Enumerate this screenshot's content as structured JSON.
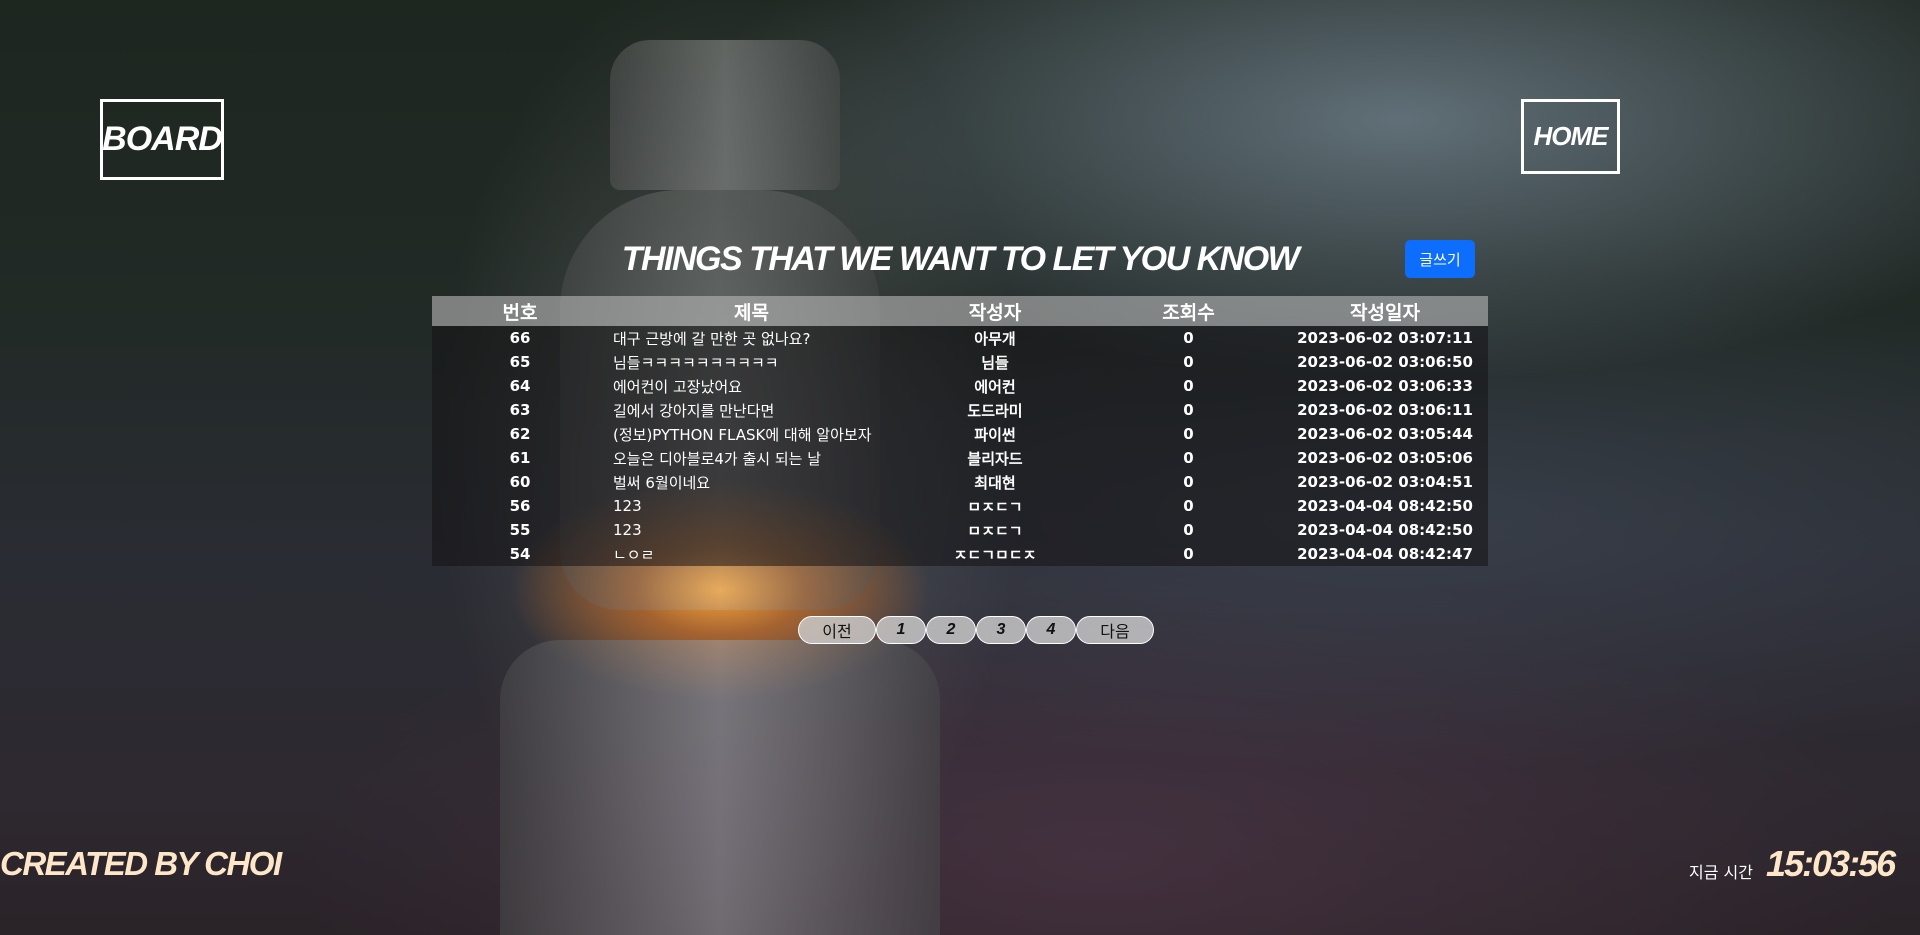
{
  "header": {
    "board_label": "BOARD",
    "home_label": "HOME"
  },
  "main": {
    "title": "THINGS THAT WE WANT TO LET YOU KNOW",
    "write_label": "글쓰기"
  },
  "table": {
    "columns": [
      "번호",
      "제목",
      "작성자",
      "조회수",
      "작성일자"
    ],
    "rows": [
      [
        "66",
        "대구 근방에 갈 만한 곳 없나요?",
        "아무개",
        "0",
        "2023-06-02 03:07:11"
      ],
      [
        "65",
        "님들ㅋㅋㅋㅋㅋㅋㅋㅋㅋㅋ",
        "님들",
        "0",
        "2023-06-02 03:06:50"
      ],
      [
        "64",
        "에어컨이 고장났어요",
        "에어컨",
        "0",
        "2023-06-02 03:06:33"
      ],
      [
        "63",
        "길에서 강아지를 만난다면",
        "도드라미",
        "0",
        "2023-06-02 03:06:11"
      ],
      [
        "62",
        "(정보)PYTHON FLASK에 대해 알아보자",
        "파이썬",
        "0",
        "2023-06-02 03:05:44"
      ],
      [
        "61",
        "오늘은 디아블로4가 출시 되는 날",
        "블리자드",
        "0",
        "2023-06-02 03:05:06"
      ],
      [
        "60",
        "벌써 6월이네요",
        "최대현",
        "0",
        "2023-06-02 03:04:51"
      ],
      [
        "56",
        "123",
        "ㅁㅈㄷㄱ",
        "0",
        "2023-04-04 08:42:50"
      ],
      [
        "55",
        "123",
        "ㅁㅈㄷㄱ",
        "0",
        "2023-04-04 08:42:50"
      ],
      [
        "54",
        "ㄴㅇㄹ",
        "ㅈㄷㄱㅁㄷㅈ",
        "0",
        "2023-04-04 08:42:47"
      ]
    ]
  },
  "pagination": {
    "prev_label": "이전",
    "pages": [
      "1",
      "2",
      "3",
      "4"
    ],
    "next_label": "다음"
  },
  "footer": {
    "created_by": "CREATED BY CHOI",
    "clock_label": "지금 시간",
    "clock_value": "15:03:56"
  },
  "colors": {
    "accent_button": "#0d6efd",
    "footer_text": "#fde7c8",
    "header_row_bg": "#b4b4b4"
  }
}
